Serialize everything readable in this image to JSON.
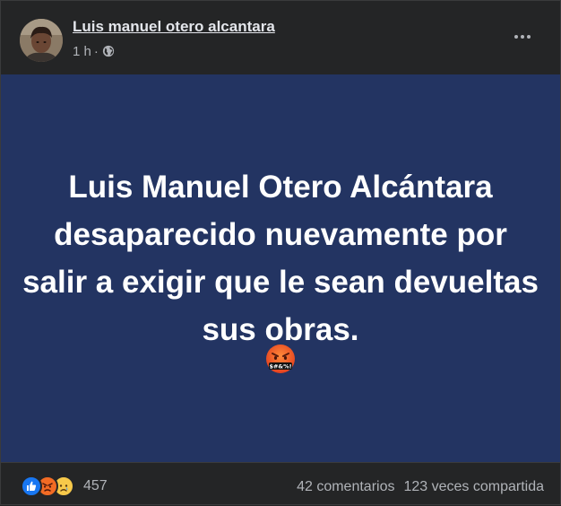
{
  "post": {
    "author": "Luis manuel otero alcantara",
    "time": "1 h",
    "separator": "·",
    "privacy_icon": "globe-icon",
    "banner_text": "Luis Manuel Otero Alcántara desaparecido nuevamente por salir a exigir que le sean devueltas sus obras.",
    "banner_emoji": "face-with-symbols-on-mouth",
    "banner_color": "#233462"
  },
  "footer": {
    "reaction_icons": [
      "like-icon",
      "angry-icon",
      "sad-icon"
    ],
    "reaction_count": "457",
    "comments": "42 comentarios",
    "shares": "123 veces compartida"
  },
  "colors": {
    "background": "#242526",
    "text_primary": "#e4e6eb",
    "text_secondary": "#b0b3b8",
    "like_blue": "#1877f2",
    "angry_orange": "#f26b24",
    "sad_yellow": "#f7c94a"
  }
}
